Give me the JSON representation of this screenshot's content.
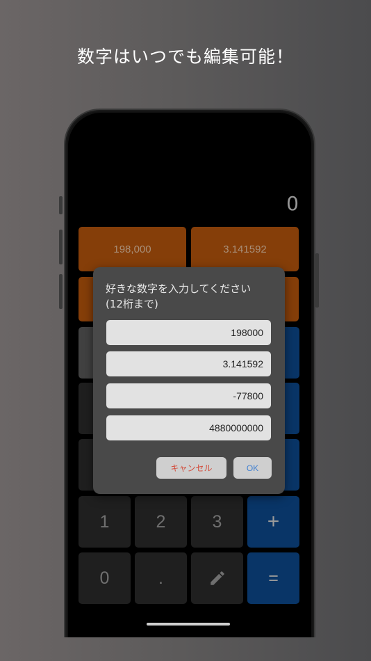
{
  "headline": "数字はいつでも編集可能！",
  "calculator": {
    "display": "0",
    "memory_slots": [
      "198,000",
      "3.141592"
    ],
    "keys_row4": [
      "1",
      "2",
      "3",
      "+"
    ],
    "keys_row5": [
      "0",
      ".",
      "edit",
      "="
    ]
  },
  "dialog": {
    "title_line1": "好きな数字を入力してください",
    "title_line2": "(12桁まで)",
    "fields": [
      "198000",
      "3.141592",
      "-77800",
      "4880000000"
    ],
    "cancel_label": "キャンセル",
    "ok_label": "OK"
  },
  "icons": {
    "edit_key": "pencil-icon"
  },
  "colors": {
    "memory_orange": "#b9560d",
    "operator_blue": "#0d4a8f",
    "cancel_red": "#d24b3a",
    "ok_blue": "#3f7fd1"
  }
}
